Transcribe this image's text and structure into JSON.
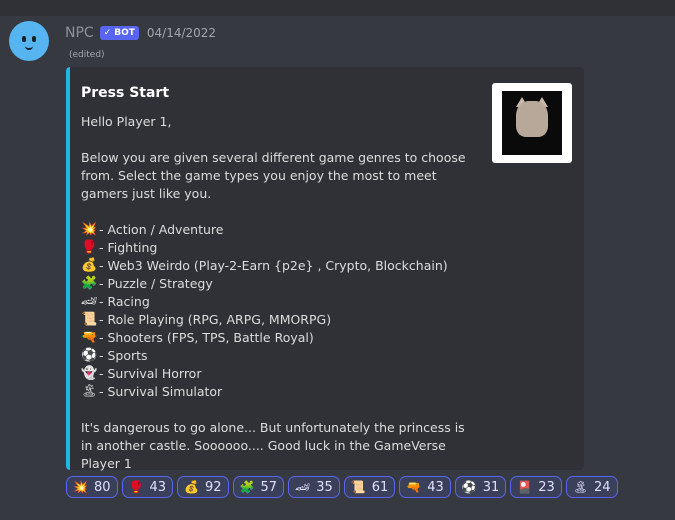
{
  "message": {
    "author": "NPC",
    "bot_tag": "BOT",
    "timestamp": "04/14/2022",
    "edited": "(edited)"
  },
  "embed": {
    "title": "Press Start",
    "greeting": "Hello Player 1,",
    "intro": "Below you are given several different game genres to choose from. Select the game types you enjoy the most to meet gamers just like you.",
    "genres": [
      {
        "emoji": "💥",
        "label": "- Action / Adventure"
      },
      {
        "emoji": "🥊",
        "label": "- Fighting"
      },
      {
        "emoji": "💰",
        "label": "- Web3 Weirdo (Play-2-Earn {p2e} , Crypto, Blockchain)"
      },
      {
        "emoji": "🧩",
        "label": "- Puzzle / Strategy"
      },
      {
        "emoji": "🏎",
        "label": "- Racing"
      },
      {
        "emoji": "📜",
        "label": "- Role Playing (RPG, ARPG, MMORPG)"
      },
      {
        "emoji": "🔫",
        "label": "- Shooters (FPS, TPS, Battle Royal)"
      },
      {
        "emoji": "⚽",
        "label": "- Sports"
      },
      {
        "emoji": "👻",
        "label": "- Survival Horror"
      },
      {
        "emoji": "🏝",
        "label": "- Survival Simulator"
      }
    ],
    "outro": "It's dangerous to go alone... But unfortunately the princess is in another castle. Soooooo.... Good luck in the GameVerse Player 1"
  },
  "reactions": [
    {
      "emoji": "💥",
      "count": "80"
    },
    {
      "emoji": "🥊",
      "count": "43"
    },
    {
      "emoji": "💰",
      "count": "92"
    },
    {
      "emoji": "🧩",
      "count": "57"
    },
    {
      "emoji": "🏎",
      "count": "35"
    },
    {
      "emoji": "📜",
      "count": "61"
    },
    {
      "emoji": "🔫",
      "count": "43"
    },
    {
      "emoji": "⚽",
      "count": "31"
    },
    {
      "emoji": "🎴",
      "count": "23"
    },
    {
      "emoji": "🏝",
      "count": "24"
    }
  ],
  "colors": {
    "background": "#36393f",
    "embed_bg": "#2f3136",
    "embed_accent": "#1fb8e3",
    "bot_tag": "#5865f2",
    "reaction_border": "#5865f2"
  }
}
